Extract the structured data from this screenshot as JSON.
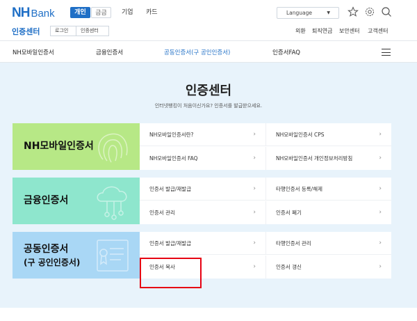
{
  "header": {
    "logo_nh": "NH",
    "logo_bank": "Bank",
    "seg_personal": "개인",
    "seg_finance": "금금",
    "seg_corp": "기업",
    "seg_card": "카드",
    "language": "Language",
    "icons": [
      "star-icon",
      "settings-icon",
      "search-icon"
    ]
  },
  "subheader": {
    "title": "인증센터",
    "login": "로그인",
    "center": "인증센터",
    "utils": [
      "외환",
      "퇴직연금",
      "보안센터",
      "고객센터"
    ]
  },
  "nav": {
    "items": [
      "NH모바일인증서",
      "금융인증서",
      "공동인증서(구 공인인증서)",
      "인증서FAQ"
    ],
    "active_index": 2
  },
  "main": {
    "title": "인증센터",
    "subtitle": "인터넷뱅킹이 처음이신가요? 인증서를 발급받으세요.",
    "cards": [
      {
        "label": "NH모바일인증서",
        "color": "#b7e886",
        "links": [
          "NH모바일인증서란?",
          "NH모바일인증서 CPS",
          "NH모바일인증서 FAQ",
          "NH모바일인증서 개인정보처리방침"
        ]
      },
      {
        "label": "금융인증서",
        "color": "#8ee6cd",
        "links": [
          "인증서 발급/재발급",
          "타행인증서 등록/해제",
          "인증서 관리",
          "인증서 폐기"
        ]
      },
      {
        "label_line1": "공동인증서",
        "label_line2": "(구 공인인증서)",
        "color": "#a9d7f5",
        "links": [
          "인증서 발급/재발급",
          "타행인증서 관리",
          "인증서 복사",
          "인증서 갱신"
        ]
      }
    ]
  },
  "colors": {
    "brand": "#1f6fc6",
    "highlight": "#e60012",
    "background": "#e8f3fb"
  }
}
